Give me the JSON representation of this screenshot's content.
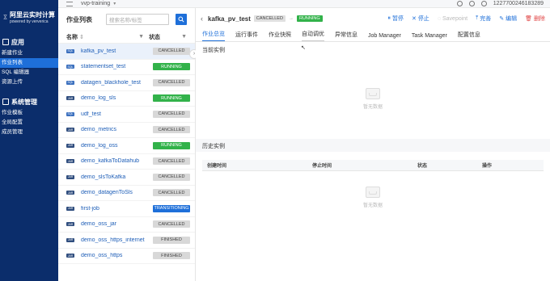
{
  "brand": {
    "title": "阿里云实时计算",
    "subtitle": "powered by ververica"
  },
  "sidebar": {
    "section_app": "应用",
    "app_items": [
      {
        "label": "新建作业",
        "active": false
      },
      {
        "label": "作业列表",
        "active": true
      },
      {
        "label": "SQL 编辑器",
        "active": false
      },
      {
        "label": "资源上传",
        "active": false
      }
    ],
    "section_sys": "系统管理",
    "sys_items": [
      {
        "label": "作业模板"
      },
      {
        "label": "全局配置"
      },
      {
        "label": "成员管理"
      }
    ]
  },
  "topbar": {
    "workspace": "vvp-training",
    "account": "1227700246183289"
  },
  "joblist": {
    "title": "作业列表",
    "search_placeholder": "搜索名称/标签",
    "col_name": "名称",
    "col_status": "状态",
    "rows": [
      {
        "type": "SQL",
        "name": "kafka_pv_test",
        "status": "CANCELLED",
        "selected": true
      },
      {
        "type": "SQL",
        "name": "statementset_test",
        "status": "RUNNING"
      },
      {
        "type": "SQL",
        "name": "datagen_blackhole_test",
        "status": "CANCELLED"
      },
      {
        "type": "JAR",
        "name": "demo_log_sls",
        "status": "RUNNING"
      },
      {
        "type": "SQL",
        "name": "udf_test",
        "status": "CANCELLED"
      },
      {
        "type": "JAR",
        "name": "demo_metrics",
        "status": "CANCELLED"
      },
      {
        "type": "JAR",
        "name": "demo_log_oss",
        "status": "RUNNING"
      },
      {
        "type": "JAR",
        "name": "demo_kafkaToDatahub",
        "status": "CANCELLED"
      },
      {
        "type": "JAR",
        "name": "demo_slsToKafka",
        "status": "CANCELLED"
      },
      {
        "type": "JAR",
        "name": "demo_datagenToSls",
        "status": "CANCELLED"
      },
      {
        "type": "JAR",
        "name": "first-job",
        "status": "TRANSITIONING"
      },
      {
        "type": "JAR",
        "name": "demo_oss_jar",
        "status": "CANCELLED"
      },
      {
        "type": "JAR",
        "name": "demo_oss_https_internet",
        "status": "FINISHED"
      },
      {
        "type": "JAR",
        "name": "demo_oss_https",
        "status": "FINISHED"
      }
    ]
  },
  "detail": {
    "job_name": "kafka_pv_test",
    "badge_state": "CANCELLED",
    "badge_target": "RUNNING",
    "actions": {
      "pause": "暂停",
      "stop": "停止",
      "savepoint": "Savepoint",
      "publish": "完善",
      "edit": "编辑",
      "delete": "删除"
    },
    "tabs": [
      "作业总览",
      "运行事件",
      "作业快照",
      "自动调优",
      "异常信息",
      "Job Manager",
      "Task Manager",
      "配置信息"
    ],
    "current_instance": "当前实例",
    "empty_text": "暂无数据",
    "history_title": "历史实例",
    "history_cols": [
      "创建时间",
      "停止时间",
      "状态",
      "操作"
    ]
  },
  "colors": {
    "sidebar": "#0b2d6b",
    "accent": "#1e6fd9",
    "running": "#32b24a",
    "danger": "#e04444"
  }
}
